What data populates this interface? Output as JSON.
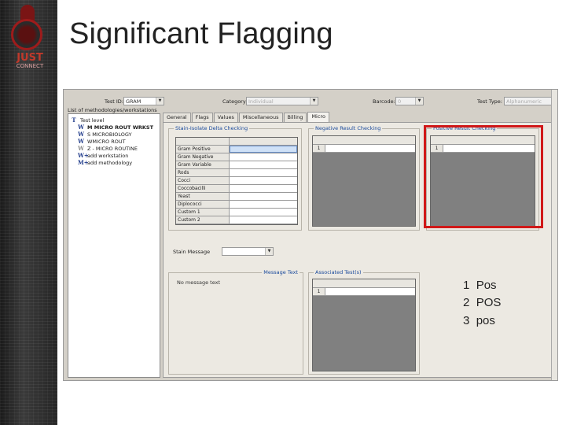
{
  "slide": {
    "title": "Significant Flagging",
    "logo_text": "JUST",
    "logo_subtext": "CONNECT"
  },
  "app": {
    "header": {
      "test_id_label": "Test ID:",
      "test_id_value": "GRAM",
      "category_label": "Category:",
      "category_value": "Individual",
      "barcode_label": "Barcode:",
      "barcode_value": "0",
      "test_type_label": "Test Type:",
      "test_type_value": "Alphanumeric"
    },
    "tree": {
      "title": "List of methodologies/workstations",
      "items": [
        {
          "icon": "T",
          "label": "Test level"
        },
        {
          "icon": "W",
          "label": "M MICRO ROUT WRKST"
        },
        {
          "icon": "W",
          "label": "S MICROBIOLOGY"
        },
        {
          "icon": "W",
          "label": "WMICRO ROUT"
        },
        {
          "icon": "W",
          "label": "Z - MICRO ROUTINE"
        },
        {
          "icon": "W+",
          "label": "add workstation"
        },
        {
          "icon": "M+",
          "label": "add methodology"
        }
      ]
    },
    "tabs": [
      "General",
      "Flags",
      "Values",
      "Miscellaneous",
      "Billing",
      "Micro"
    ],
    "stain_group": {
      "title": "Stain-Isolate Delta Checking",
      "rows": [
        "Gram Positive",
        "Gram Negative",
        "Gram Variable",
        "Rods",
        "Cocci",
        "Coccobacilli",
        "Yeast",
        "Diplococci",
        "Custom 1",
        "Custom 2"
      ]
    },
    "negative_group": {
      "title": "Negative Result Checking",
      "row_number": "1"
    },
    "positive_group": {
      "title": "Positive Result Checking",
      "row_number": "1"
    },
    "stain_message_label": "Stain Message",
    "message_text_title": "Message Text",
    "message_text_value": "No message text",
    "associated_tests": {
      "title": "Associated Test(s)",
      "row_number": "1"
    }
  },
  "notes": [
    {
      "num": "1",
      "text": "Pos"
    },
    {
      "num": "2",
      "text": "POS"
    },
    {
      "num": "3",
      "text": "pos"
    }
  ],
  "colors": {
    "highlight": "#d01818",
    "group_title": "#1a4a9c"
  }
}
